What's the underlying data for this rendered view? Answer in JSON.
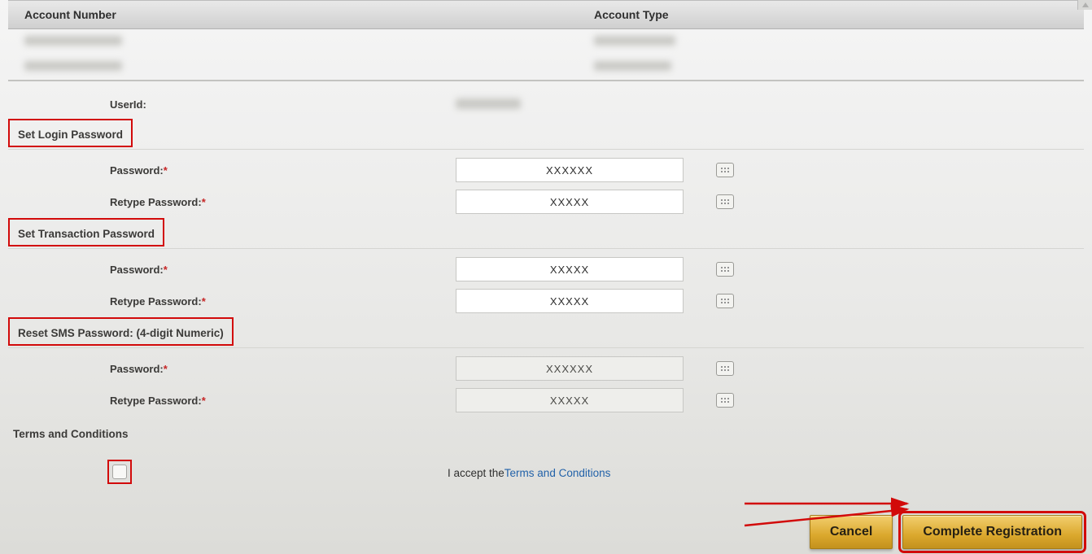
{
  "table": {
    "headers": {
      "account_number": "Account Number",
      "account_type": "Account Type"
    }
  },
  "userid_label": "UserId:",
  "sections": {
    "login": "Set Login Password",
    "transaction": "Set Transaction Password",
    "sms": "Reset SMS Password: (4-digit Numeric)"
  },
  "labels": {
    "password": "Password:",
    "retype_password": "Retype Password:"
  },
  "fields": {
    "login_password": "XXXXXX",
    "login_retype": "XXXXX",
    "txn_password": "XXXXX",
    "txn_retype": "XXXXX",
    "sms_password": "XXXXXX",
    "sms_retype": "XXXXX"
  },
  "terms": {
    "heading": "Terms and Conditions",
    "accept_prefix": "I accept the",
    "link_text": "Terms and Conditions"
  },
  "buttons": {
    "cancel": "Cancel",
    "complete": "Complete Registration"
  }
}
